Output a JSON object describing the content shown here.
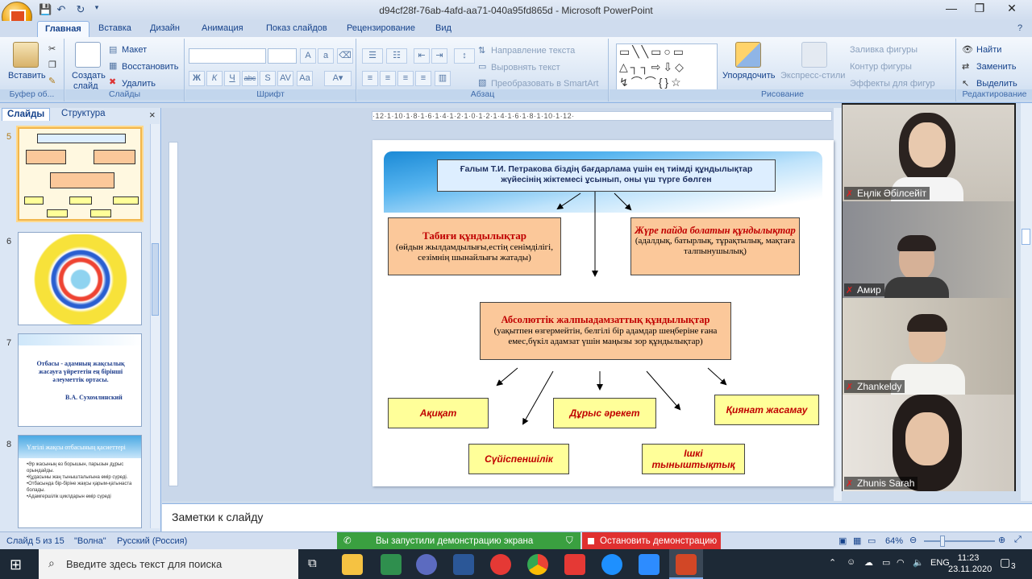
{
  "window": {
    "title": "d94cf28f-76ab-4afd-aa71-040a95fd865d - Microsoft PowerPoint"
  },
  "tabs": [
    "Главная",
    "Вставка",
    "Дизайн",
    "Анимация",
    "Показ слайдов",
    "Рецензирование",
    "Вид"
  ],
  "ribbon": {
    "clipboard": {
      "label": "Буфер об...",
      "paste": "Вставить"
    },
    "slides": {
      "label": "Слайды",
      "create": "Создать",
      "create2": "слайд",
      "layout": "Макет",
      "reset": "Восстановить",
      "delete": "Удалить"
    },
    "font": {
      "label": "Шрифт"
    },
    "paragraph": {
      "label": "Абзац",
      "text_dir": "Направление текста",
      "align_text": "Выровнять текст",
      "smartart": "Преобразовать в SmartArt"
    },
    "drawing": {
      "label": "Рисование",
      "arrange": "Упорядочить",
      "quick_styles": "Экспресс-стили",
      "fill": "Заливка фигуры",
      "outline": "Контур фигуры",
      "effects": "Эффекты для фигур"
    },
    "editing": {
      "label": "Редактирование",
      "find": "Найти",
      "replace": "Заменить",
      "select": "Выделить"
    }
  },
  "pane": {
    "tab_slides": "Слайды",
    "tab_outline": "Структура",
    "close": "×"
  },
  "thumbs": [
    {
      "num": "5"
    },
    {
      "num": "6"
    },
    {
      "num": "7",
      "text": "Отбасы - адамның жақсылық жасауға үйрететін ең бірінші әлеуметтік ортасы.",
      "author": "В.А. Сухомлинский"
    },
    {
      "num": "8",
      "title": "Үлгілі жақсы отбасының қасиеттері",
      "lines": [
        "•Әр жасының өз борышын, парызын дұрыс орындайды.",
        "•Құдасыны жаң тынышталығына өмір сүреді.",
        "•Отбасында бір-біріне жақсы қарым-қатынаста болады.",
        "•Адамгершілік циклдарын өмір сүреді"
      ]
    }
  ],
  "ruler_text": "·12·1·10·1·8·1·6·1·4·1·2·1·0·1·2·1·4·1·6·1·8·1·10·1·12·",
  "slide": {
    "header": "Ғалым Т.И. Петракова біздің бағдарлама үшін  ең тиімді құндылықтар жүйесінің жіктемесі ұсынып, оны үш түрге бөлген",
    "box1_title": "Табиғи құндылықтар",
    "box1_text": "(өйдын жылдамдылығы,естің сенімділігі, сезімнің шынайлығы  жатады)",
    "box2_title": "Жүре пайда болатын құндылықтар",
    "box2_text": "(адалдық, батырлық, тұрақтылық, мақтаға талпынушылық)",
    "box3_title": "Абсолюттік жалпыадамзаттық құндылықтар",
    "box3_text": "(уақытпен өзгермейтін, белгілі бір адамдар шеңберіне ғана емес,бүкіл адамзат үшін маңызы зор  құндылықтар)",
    "v1": "Ақиқат",
    "v2": "Дұрыс әрекет",
    "v3": "Қиянат жасамау",
    "v4": "Сүйіспеншілік",
    "v5": "Ішкі тыныштықтық"
  },
  "notes": "Заметки к слайду",
  "status": {
    "slide": "Слайд 5 из 15",
    "theme": "\"Волна\"",
    "lang": "Русский (Россия)",
    "share": "Вы запустили демонстрацию экрана",
    "stop": "Остановить демонстрацию",
    "zoom": "64%"
  },
  "videos": [
    {
      "name": "Еңлік Әбілсейіт"
    },
    {
      "name": "Амир"
    },
    {
      "name": "Zhankeldy"
    },
    {
      "name": "Zhunis Sarah"
    }
  ],
  "taskbar": {
    "search": "Введите здесь текст для поиска",
    "lang": "ENG",
    "time": "11:23",
    "date": "23.11.2020",
    "notif": "3"
  }
}
